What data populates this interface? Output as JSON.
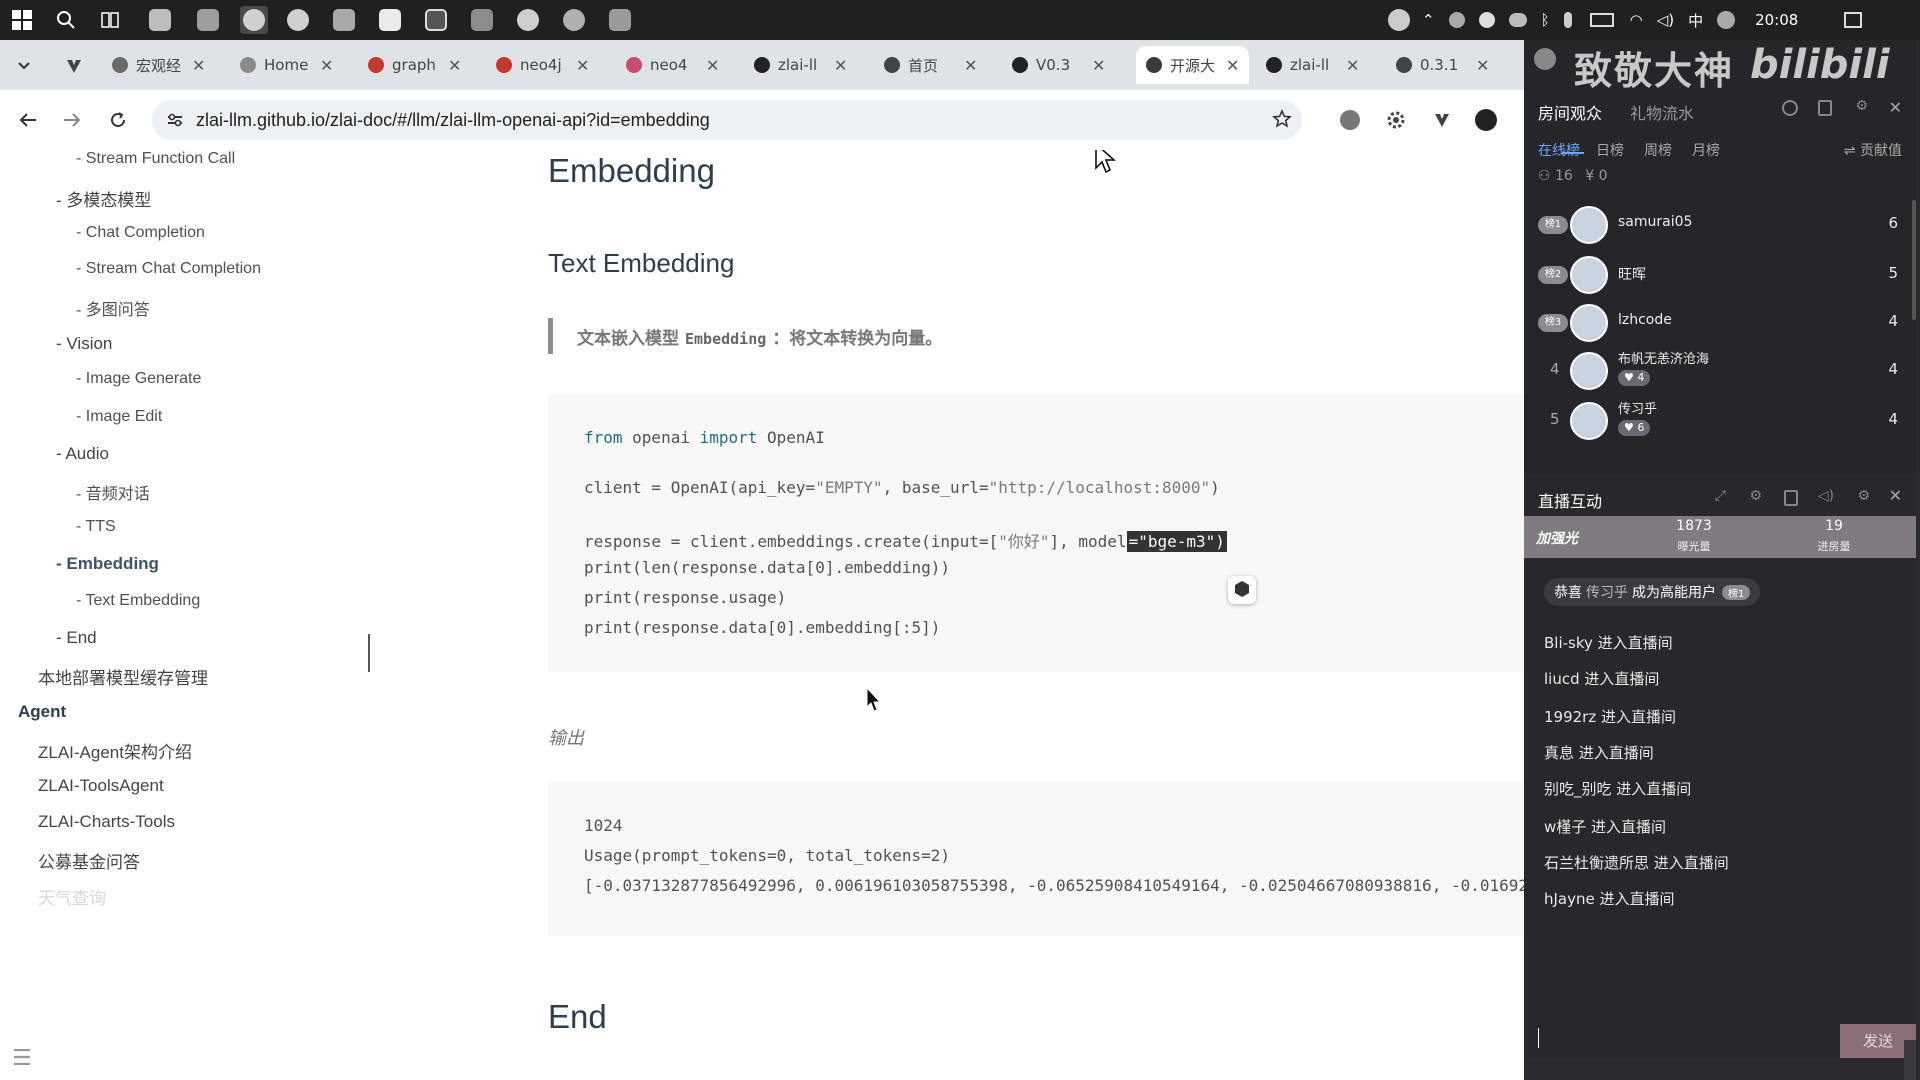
{
  "taskbar": {
    "tray": {
      "lang": "中",
      "time": "20:08"
    }
  },
  "browser": {
    "tabs": [
      {
        "label": "宏观经",
        "favicon_color": "#6a6a6a"
      },
      {
        "label": "Home",
        "favicon_color": "#8a8a8a"
      },
      {
        "label": "graph",
        "favicon_color": "#c0392b"
      },
      {
        "label": "neo4j",
        "favicon_color": "#c0392b"
      },
      {
        "label": "neo4",
        "favicon_color": "#c94b6d"
      },
      {
        "label": "zlai-ll",
        "favicon_color": "#222222"
      },
      {
        "label": "首页",
        "favicon_color": "#444444"
      },
      {
        "label": "V0.3",
        "favicon_color": "#222222"
      },
      {
        "label": "开源大",
        "favicon_color": "#3a3a3a"
      },
      {
        "label": "zlai-ll",
        "favicon_color": "#222222"
      },
      {
        "label": "0.3.1",
        "favicon_color": "#444444"
      }
    ],
    "url": "zlai-llm.github.io/zlai-doc/#/llm/zlai-llm-openai-api?id=embedding"
  },
  "sidebar": {
    "items": [
      {
        "label": "- Stream Function Call",
        "level": 2
      },
      {
        "label": "- 多模态模型",
        "level": 1
      },
      {
        "label": "- Chat Completion",
        "level": 2
      },
      {
        "label": "- Stream Chat Completion",
        "level": 2
      },
      {
        "label": "- 多图问答",
        "level": 2
      },
      {
        "label": "- Vision",
        "level": 1
      },
      {
        "label": "- Image Generate",
        "level": 2
      },
      {
        "label": "- Image Edit",
        "level": 2
      },
      {
        "label": "- Audio",
        "level": 1
      },
      {
        "label": "- 音频对话",
        "level": 2
      },
      {
        "label": "- TTS",
        "level": 2
      },
      {
        "label": "- Embedding",
        "level": 1,
        "active": true
      },
      {
        "label": "- Text Embedding",
        "level": 2
      },
      {
        "label": "- End",
        "level": 1
      },
      {
        "label": "本地部署模型缓存管理",
        "level": 1
      },
      {
        "label": "Agent",
        "level": 0
      },
      {
        "label": "ZLAI-Agent架构介绍",
        "level": 1
      },
      {
        "label": "ZLAI-ToolsAgent",
        "level": 1
      },
      {
        "label": "ZLAI-Charts-Tools",
        "level": 1
      },
      {
        "label": "公募基金问答",
        "level": 1
      },
      {
        "label": "天气查询",
        "level": 1
      }
    ]
  },
  "content": {
    "h1": "Embedding",
    "h2": "Text Embedding",
    "quote": {
      "prefix": "文本嵌入模型",
      "code": "Embedding",
      "suffix": "：将文本转换为向量。"
    },
    "code": {
      "line1": {
        "kw1": "from",
        "mod": " openai ",
        "kw2": "import",
        "cls": " OpenAI"
      },
      "line2": {
        "pre": "client = OpenAI(api_key=",
        "k": "\"EMPTY\"",
        "mid": ", base_url=",
        "u": "\"http://localhost:8000\"",
        "post": ")"
      },
      "line3": {
        "pre": "response = client.embeddings.create(input=[",
        "v": "\"你好\"",
        "mid": "], model",
        "sel": "=\"bge-m3\")"
      },
      "line4": "print(len(response.data[0].embedding))",
      "line5": "print(response.usage)",
      "line6": "print(response.data[0].embedding[:5])"
    },
    "output_label": "输出",
    "output": {
      "line1": "1024",
      "line2": "Usage(prompt_tokens=0, total_tokens=2)",
      "line3": "[-0.037132877856492996, 0.006196103058755398, -0.06525908410549164, -0.02504667080938816, -0.01692"
    },
    "end_heading": "End"
  },
  "live": {
    "watermark": "致敬大神",
    "watermark2": "bilibili",
    "tabs": {
      "audience": "房间观众",
      "gifts": "礼物流水"
    },
    "rank_tabs": [
      "在线榜",
      "日榜",
      "周榜",
      "月榜"
    ],
    "contribution": "贡献值",
    "stats": {
      "online": "16",
      "currency": "0"
    },
    "viewers": [
      {
        "rank": "榜1",
        "name": "samurai05",
        "score": "6"
      },
      {
        "rank": "榜2",
        "name": "旺晖",
        "score": "5"
      },
      {
        "rank": "榜3",
        "name": "lzhcode",
        "score": "4"
      },
      {
        "rank": "4",
        "name": "布帆无恙济沧海",
        "medal": "4",
        "score": "4"
      },
      {
        "rank": "5",
        "name": "传习乎",
        "medal": "6",
        "score": "4"
      }
    ],
    "interact_title": "直播互动",
    "banner": {
      "label": "加强光",
      "v1": "1873",
      "l1": "曝光量",
      "v2": "19",
      "l2": "进房量"
    },
    "congrats": {
      "pre": "恭喜",
      "user": "传习乎",
      "post": "成为高能用户",
      "badge": "榜1"
    },
    "messages": [
      {
        "text": "Bli-sky 进入直播间"
      },
      {
        "text": "liucd 进入直播间"
      },
      {
        "text": "1992rz 进入直播间"
      },
      {
        "text": "真息 进入直播间"
      },
      {
        "text": "别吃_别吃 进入直播间"
      },
      {
        "text": "w槿子 进入直播间"
      },
      {
        "text": "石兰杜衡遗所思 进入直播间"
      },
      {
        "text": "hJayne 进入直播间"
      }
    ],
    "send_label": "发送"
  }
}
